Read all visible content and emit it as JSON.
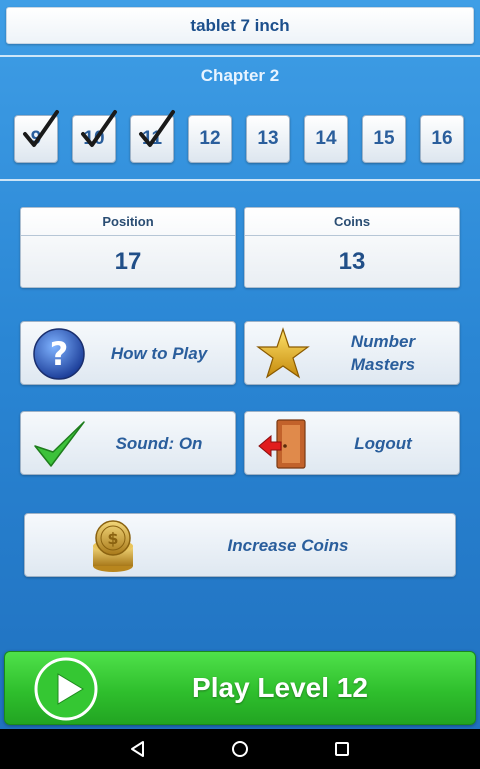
{
  "header": {
    "title": "tablet 7 inch"
  },
  "chapter": {
    "label": "Chapter 2"
  },
  "levels": [
    {
      "label": "9",
      "completed": true
    },
    {
      "label": "10",
      "completed": true
    },
    {
      "label": "11",
      "completed": true
    },
    {
      "label": "12",
      "completed": false
    },
    {
      "label": "13",
      "completed": false
    },
    {
      "label": "14",
      "completed": false
    },
    {
      "label": "15",
      "completed": false
    },
    {
      "label": "16",
      "completed": false
    }
  ],
  "stats": {
    "position": {
      "label": "Position",
      "value": "17"
    },
    "coins": {
      "label": "Coins",
      "value": "13"
    }
  },
  "buttons": {
    "how_to_play": {
      "label": "How to Play",
      "icon": "question-icon"
    },
    "number_masters": {
      "label_line1": "Number",
      "label_line2": "Masters",
      "icon": "star-icon"
    },
    "sound": {
      "label": "Sound: On",
      "icon": "checkmark-icon"
    },
    "logout": {
      "label": "Logout",
      "icon": "door-exit-icon"
    },
    "increase_coins": {
      "label": "Increase Coins",
      "icon": "coin-stack-icon"
    }
  },
  "play": {
    "label": "Play Level 12",
    "icon": "play-icon"
  },
  "colors": {
    "background": "#2a86d4",
    "button_text": "#2a5e9c",
    "play_green": "#2fbf2d"
  }
}
